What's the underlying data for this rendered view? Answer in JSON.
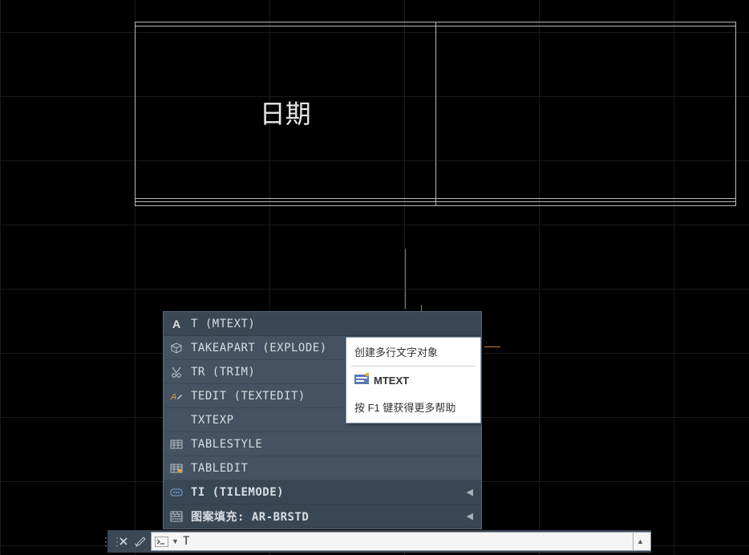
{
  "drawing": {
    "cell_text": "日期"
  },
  "autocomplete": {
    "items": [
      {
        "icon": "text-a-icon",
        "label": "T (MTEXT)",
        "selected": true,
        "has_arrow": false
      },
      {
        "icon": "box-icon",
        "label": "TAKEAPART (EXPLODE)",
        "selected": false,
        "has_arrow": false
      },
      {
        "icon": "trim-icon",
        "label": "TR (TRIM)",
        "selected": false,
        "has_arrow": false
      },
      {
        "icon": "textedit-icon",
        "label": "TEDIT (TEXTEDIT)",
        "selected": false,
        "has_arrow": false
      },
      {
        "icon": "",
        "label": "TXTEXP",
        "selected": false,
        "has_arrow": false
      },
      {
        "icon": "tablestyle-icon",
        "label": "TABLESTYLE",
        "selected": false,
        "has_arrow": false
      },
      {
        "icon": "tabledit-icon",
        "label": "TABLEDIT",
        "selected": false,
        "has_arrow": false
      },
      {
        "icon": "var-icon",
        "label": "TI (TILEMODE)",
        "selected": false,
        "has_arrow": true,
        "dark": true,
        "bold": true
      },
      {
        "icon": "hatch-icon",
        "label": "图案填充: AR-BRSTD",
        "selected": false,
        "has_arrow": true,
        "dark": true,
        "bold": true
      }
    ]
  },
  "tooltip": {
    "description": "创建多行文字对象",
    "command": "MTEXT",
    "help_text": "按 F1 键获得更多帮助"
  },
  "command_input": {
    "value": "T"
  }
}
